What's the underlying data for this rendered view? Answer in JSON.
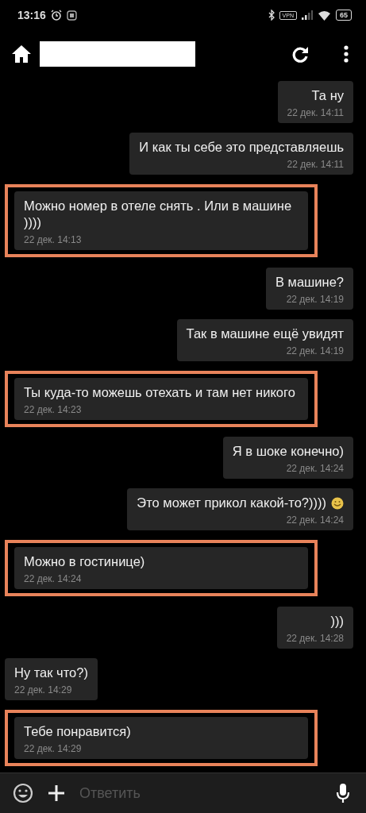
{
  "status_bar": {
    "time": "13:16",
    "vpn": "VPN",
    "battery": "65"
  },
  "header": {
    "redacted": true
  },
  "messages": [
    {
      "text": "Та ну",
      "time": "22 дек. 14:11",
      "outgoing": true,
      "highlighted": false
    },
    {
      "text": "И как ты себе это представляешь",
      "time": "22 дек. 14:11",
      "outgoing": true,
      "highlighted": false
    },
    {
      "text": "Можно номер в отеле снять .  Или в машине ))))",
      "time": "22 дек. 14:13",
      "outgoing": false,
      "highlighted": true
    },
    {
      "text": "В машине?",
      "time": "22 дек. 14:19",
      "outgoing": true,
      "highlighted": false
    },
    {
      "text": "Так в машине ещё увидят",
      "time": "22 дек. 14:19",
      "outgoing": true,
      "highlighted": false
    },
    {
      "text": "Ты куда-то можешь отехать и там нет никого",
      "time": "22 дек. 14:23",
      "outgoing": false,
      "highlighted": true
    },
    {
      "text": "Я в шоке конечно)",
      "time": "22 дек. 14:24",
      "outgoing": true,
      "highlighted": false
    },
    {
      "text": "Это может прикол какой-то?))))",
      "time": "22 дек. 14:24",
      "outgoing": true,
      "highlighted": false,
      "emoji": true
    },
    {
      "text": "Можно в гостинице)",
      "time": "22 дек. 14:24",
      "outgoing": false,
      "highlighted": true
    },
    {
      "text": ")))",
      "time": "22 дек. 14:28",
      "outgoing": true,
      "highlighted": false
    },
    {
      "text": "Ну так что?)",
      "time": "22 дек. 14:29",
      "outgoing": false,
      "highlighted": false
    },
    {
      "text": "Тебе понравится)",
      "time": "22 дек. 14:29",
      "outgoing": false,
      "highlighted": true
    }
  ],
  "composer": {
    "placeholder": "Ответить"
  }
}
